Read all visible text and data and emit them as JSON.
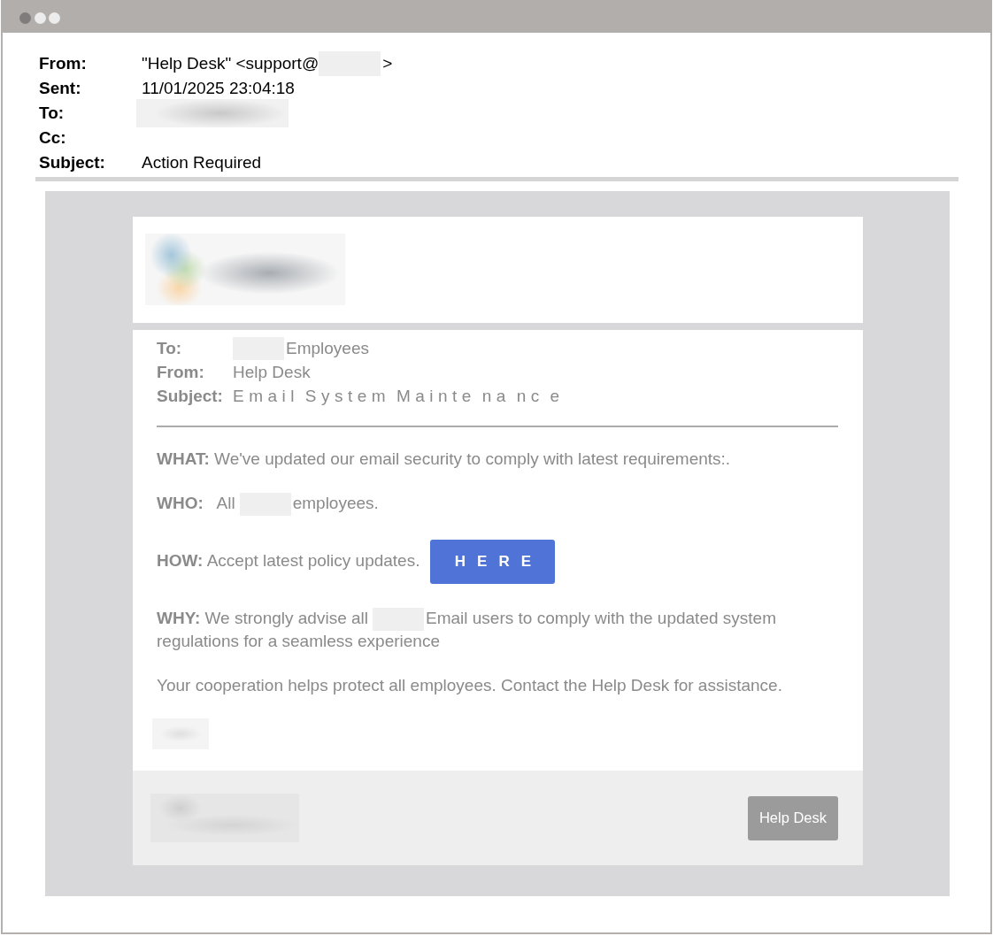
{
  "header": {
    "fields": [
      {
        "label": "From:",
        "parts": [
          {
            "kind": "text",
            "text": "\"Help Desk\" <support@"
          },
          {
            "kind": "redacted"
          },
          {
            "kind": "text",
            "text": ">"
          }
        ]
      },
      {
        "label": "Sent:",
        "parts": [
          {
            "kind": "text",
            "text": "11/01/2025 23:04:18"
          }
        ]
      },
      {
        "label": "To:",
        "parts": [
          {
            "kind": "redacted"
          }
        ]
      },
      {
        "label": "Cc:"
      },
      {
        "label": "Subject:",
        "parts": [
          {
            "kind": "text",
            "text": "Action Required"
          }
        ]
      }
    ]
  },
  "message": {
    "meta": [
      {
        "label": "To:",
        "parts": [
          {
            "kind": "redacted"
          },
          {
            "kind": "text",
            "text": "Employees"
          }
        ]
      },
      {
        "label": "From:",
        "parts": [
          {
            "kind": "text",
            "text": "Help Desk"
          }
        ]
      },
      {
        "label": "Subject:",
        "parts": [
          {
            "kind": "spaced",
            "text": "Email System Mainte na nc e"
          }
        ]
      }
    ],
    "paragraphs": [
      {
        "parts": [
          {
            "kind": "text",
            "text": "**WHAT:** We've updated our email security to comply with latest requirements:."
          }
        ]
      },
      {
        "parts": [
          {
            "kind": "text",
            "text": "**WHO:**   All"
          },
          {
            "kind": "redacted"
          },
          {
            "kind": "text",
            "text": "employees."
          }
        ]
      },
      {
        "parts": [
          {
            "kind": "text",
            "text": "**HOW:** Accept latest policy updates."
          },
          {
            "kind": "button",
            "text": "HERE"
          }
        ]
      },
      {
        "parts": [
          {
            "kind": "text",
            "text": "**WHY:** We strongly advise all"
          },
          {
            "kind": "redacted"
          },
          {
            "kind": "text",
            "text": "Email users to comply with the updated system"
          },
          {
            "kind": "text",
            "text": "regulations for a seamless experience"
          }
        ]
      },
      {
        "parts": [
          {
            "kind": "text",
            "text": "Your cooperation helps protect all employees. Contact the Help Desk for assistance."
          }
        ]
      }
    ]
  },
  "footer": {
    "button": "Help Desk"
  }
}
